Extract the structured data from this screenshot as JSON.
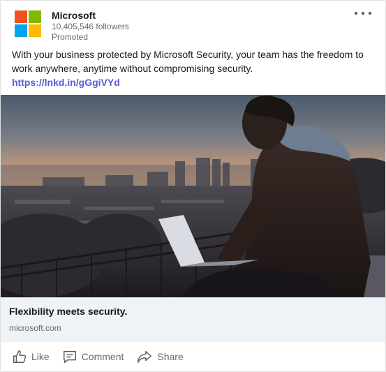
{
  "post": {
    "company_name": "Microsoft",
    "followers": "10,405,546 followers",
    "promoted": "Promoted",
    "body_text": "With your business protected by Microsoft Security, your team has the freedom to work anywhere, anytime without compromising security.",
    "link_text": "https://lnkd.in/gGgiVYd"
  },
  "logo_colors": [
    "#f25022",
    "#7fba00",
    "#00a4ef",
    "#ffb900"
  ],
  "hero_icon": "photo-man-laptop-city-sunset",
  "caption": {
    "title": "Flexibility meets security.",
    "domain": "microsoft.com"
  },
  "actions": {
    "like": "Like",
    "comment": "Comment",
    "share": "Share"
  }
}
